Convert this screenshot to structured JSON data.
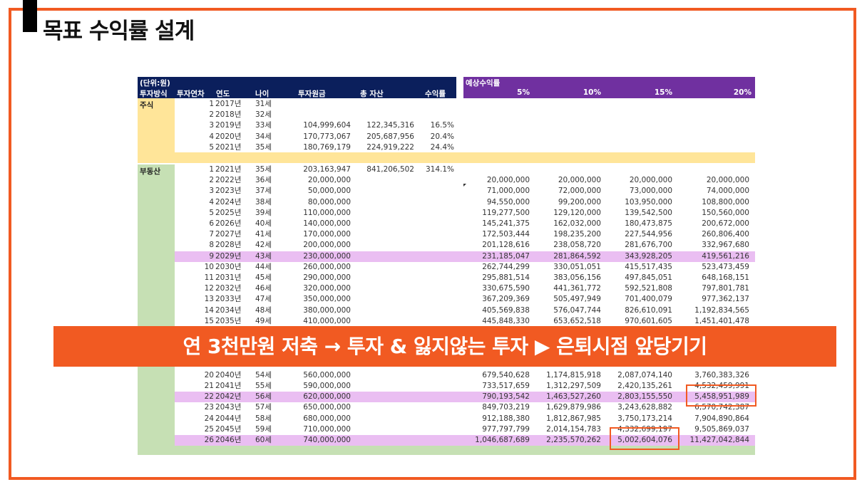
{
  "page_title": "목표 수익률 설계",
  "banner_text": "연 3천만원 저축 → 투자 & 잃지않는 투자 ▶ 은퇴시점 앞당기기",
  "colors": {
    "accent": "#f15a22",
    "header_left": "#0b1f5c",
    "header_right": "#7030a0",
    "stock": "#ffe599",
    "real_estate": "#c6e0b4",
    "highlight": "#eabef2"
  },
  "table": {
    "unit_label": "(단위:원)",
    "headers": {
      "method": "투자방식",
      "year_index": "투자연차",
      "year": "연도",
      "age": "나이",
      "principal": "투자원금",
      "total_assets": "총 자산",
      "return_rate": "수익률"
    },
    "expected_label": "예상수익률",
    "expected_rates": [
      "5%",
      "10%",
      "15%",
      "20%"
    ],
    "stock": {
      "label": "주식",
      "rows": [
        [
          "1",
          "2017년",
          "31세",
          "",
          "",
          "",
          "",
          "",
          "",
          ""
        ],
        [
          "2",
          "2018년",
          "32세",
          "",
          "",
          "",
          "",
          "",
          "",
          ""
        ],
        [
          "3",
          "2019년",
          "33세",
          "104,999,604",
          "122,345,316",
          "16.5%",
          "",
          "",
          "",
          ""
        ],
        [
          "4",
          "2020년",
          "34세",
          "170,773,067",
          "205,687,956",
          "20.4%",
          "",
          "",
          "",
          ""
        ],
        [
          "5",
          "2021년",
          "35세",
          "180,769,179",
          "224,919,222",
          "24.4%",
          "",
          "",
          "",
          ""
        ]
      ]
    },
    "real_estate": {
      "label": "부동산",
      "highlight_rows": [
        9,
        22,
        26
      ],
      "rows": [
        [
          "1",
          "2021년",
          "35세",
          "203,163,947",
          "841,206,502",
          "314.1%",
          "",
          "",
          "",
          ""
        ],
        [
          "2",
          "2022년",
          "36세",
          "20,000,000",
          "",
          "",
          "20,000,000",
          "20,000,000",
          "20,000,000",
          "20,000,000"
        ],
        [
          "3",
          "2023년",
          "37세",
          "50,000,000",
          "",
          "",
          "71,000,000",
          "72,000,000",
          "73,000,000",
          "74,000,000"
        ],
        [
          "4",
          "2024년",
          "38세",
          "80,000,000",
          "",
          "",
          "94,550,000",
          "99,200,000",
          "103,950,000",
          "108,800,000"
        ],
        [
          "5",
          "2025년",
          "39세",
          "110,000,000",
          "",
          "",
          "119,277,500",
          "129,120,000",
          "139,542,500",
          "150,560,000"
        ],
        [
          "6",
          "2026년",
          "40세",
          "140,000,000",
          "",
          "",
          "145,241,375",
          "162,032,000",
          "180,473,875",
          "200,672,000"
        ],
        [
          "7",
          "2027년",
          "41세",
          "170,000,000",
          "",
          "",
          "172,503,444",
          "198,235,200",
          "227,544,956",
          "260,806,400"
        ],
        [
          "8",
          "2028년",
          "42세",
          "200,000,000",
          "",
          "",
          "201,128,616",
          "238,058,720",
          "281,676,700",
          "332,967,680"
        ],
        [
          "9",
          "2029년",
          "43세",
          "230,000,000",
          "",
          "",
          "231,185,047",
          "281,864,592",
          "343,928,205",
          "419,561,216"
        ],
        [
          "10",
          "2030년",
          "44세",
          "260,000,000",
          "",
          "",
          "262,744,299",
          "330,051,051",
          "415,517,435",
          "523,473,459"
        ],
        [
          "11",
          "2031년",
          "45세",
          "290,000,000",
          "",
          "",
          "295,881,514",
          "383,056,156",
          "497,845,051",
          "648,168,151"
        ],
        [
          "12",
          "2032년",
          "46세",
          "320,000,000",
          "",
          "",
          "330,675,590",
          "441,361,772",
          "592,521,808",
          "797,801,781"
        ],
        [
          "13",
          "2033년",
          "47세",
          "350,000,000",
          "",
          "",
          "367,209,369",
          "505,497,949",
          "701,400,079",
          "977,362,137"
        ],
        [
          "14",
          "2034년",
          "48세",
          "380,000,000",
          "",
          "",
          "405,569,838",
          "576,047,744",
          "826,610,091",
          "1,192,834,565"
        ],
        [
          "15",
          "2035년",
          "49세",
          "410,000,000",
          "",
          "",
          "445,848,330",
          "653,652,518",
          "970,601,605",
          "1,451,401,478"
        ],
        [
          "",
          "",
          "",
          "",
          "",
          "",
          "",
          "",
          "",
          ""
        ],
        [
          "",
          "",
          "",
          "",
          "",
          "",
          "",
          "",
          "",
          ""
        ],
        [
          "",
          "",
          "",
          "",
          "",
          "",
          "",
          "",
          "",
          ""
        ],
        [
          "",
          "",
          "",
          "",
          "",
          "",
          "",
          "",
          "",
          ""
        ],
        [
          "20",
          "2040년",
          "54세",
          "560,000,000",
          "",
          "",
          "679,540,628",
          "1,174,815,918",
          "2,087,074,140",
          "3,760,383,326"
        ],
        [
          "21",
          "2041년",
          "55세",
          "590,000,000",
          "",
          "",
          "733,517,659",
          "1,312,297,509",
          "2,420,135,261",
          "4,532,459,991"
        ],
        [
          "22",
          "2042년",
          "56세",
          "620,000,000",
          "",
          "",
          "790,193,542",
          "1,463,527,260",
          "2,803,155,550",
          "5,458,951,989"
        ],
        [
          "23",
          "2043년",
          "57세",
          "650,000,000",
          "",
          "",
          "849,703,219",
          "1,629,879,986",
          "3,243,628,882",
          "6,570,742,387"
        ],
        [
          "24",
          "2044년",
          "58세",
          "680,000,000",
          "",
          "",
          "912,188,380",
          "1,812,867,985",
          "3,750,173,214",
          "7,904,890,864"
        ],
        [
          "25",
          "2045년",
          "59세",
          "710,000,000",
          "",
          "",
          "977,797,799",
          "2,014,154,783",
          "4,332,699,197",
          "9,505,869,037"
        ],
        [
          "26",
          "2046년",
          "60세",
          "740,000,000",
          "",
          "",
          "1,046,687,689",
          "2,235,570,262",
          "5,002,604,076",
          "11,427,042,844"
        ]
      ]
    }
  }
}
